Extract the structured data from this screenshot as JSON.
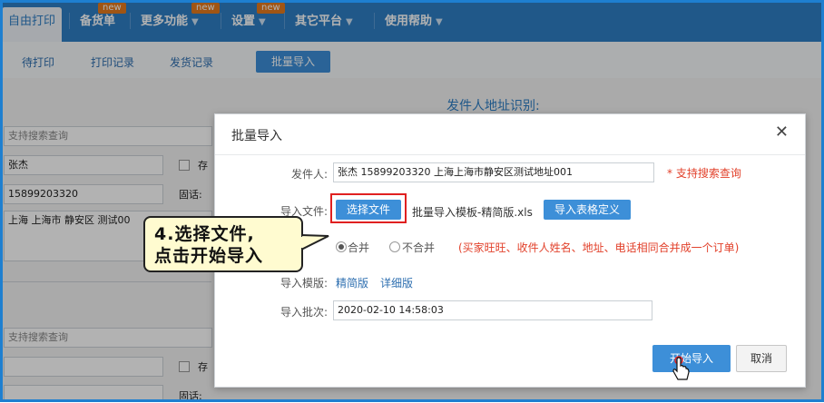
{
  "topnav": {
    "active": "自由打印",
    "items": [
      {
        "label": "备货单",
        "badge": "new",
        "arrow": ""
      },
      {
        "label": "更多功能",
        "badge": "new",
        "arrow": "▼"
      },
      {
        "label": "设置",
        "badge": "new",
        "arrow": "▼"
      },
      {
        "label": "其它平台",
        "badge": "",
        "arrow": "▼"
      },
      {
        "label": "使用帮助",
        "badge": "",
        "arrow": "▼"
      }
    ]
  },
  "subnav": {
    "tabs": [
      "待打印",
      "打印记录",
      "发货记录"
    ],
    "button": "批量导入"
  },
  "background": {
    "section_title": "发件人地址识别:",
    "search_placeholder_1": "支持搜索查询",
    "name_value": "张杰",
    "check_label_1": "存",
    "phone_value": "15899203320",
    "phone_label_1": "固话:",
    "address_value": "上海 上海市 静安区 测试00",
    "search_placeholder_2": "支持搜索查询",
    "check_label_2": "存",
    "phone_label_2": "固话:"
  },
  "modal": {
    "title": "批量导入",
    "close_icon": "close-icon",
    "sender_label": "发件人:",
    "sender_value": "张杰  15899203320  上海上海市静安区测试地址001",
    "sender_note": "* 支持搜索查询",
    "file_label": "导入文件:",
    "choose_file_button": "选择文件",
    "file_name": "批量导入模板-精简版.xls",
    "define_button": "导入表格定义",
    "merge_options": [
      "合并",
      "不合并"
    ],
    "merge_note": "(买家旺旺、收件人姓名、地址、电话相同合并成一个订单)",
    "template_label": "导入模版:",
    "template_links": [
      "精简版",
      "详细版"
    ],
    "batch_label": "导入批次:",
    "batch_value": "2020-02-10 14:58:03",
    "start_button": "开始导入",
    "cancel_button": "取消"
  },
  "callout": {
    "text": "4.选择文件,\n点击开始导入"
  },
  "colors": {
    "nav_blue": "#2e7ec4",
    "button_blue": "#3d8fd8",
    "badge_orange": "#e67a1e",
    "note_red": "#e2412b",
    "callout_yellow": "#fffbd0"
  }
}
